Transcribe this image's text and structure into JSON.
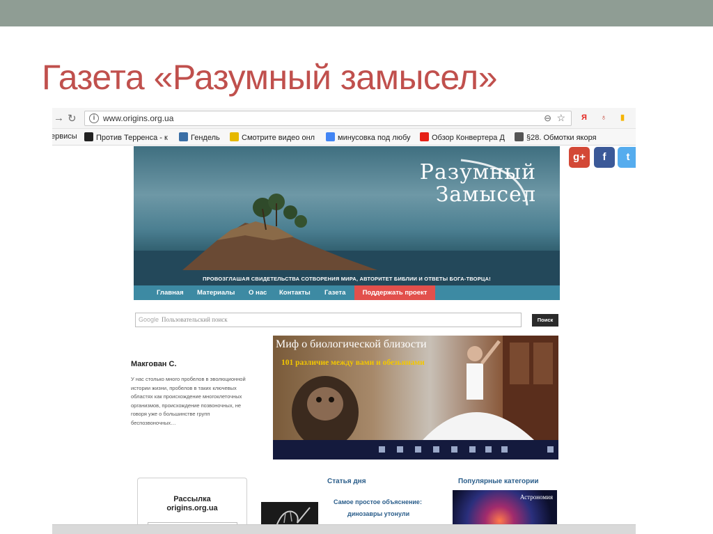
{
  "slide": {
    "title": "Газета «Разумный замысел»"
  },
  "browser": {
    "url": "www.origins.org.ua",
    "bookmarks": [
      {
        "label": "ервисы",
        "icon": "services-icon",
        "color": "#888888"
      },
      {
        "label": "Против Терренса - к",
        "icon": "bookmark-page-icon",
        "color": "#222222"
      },
      {
        "label": "Гендель",
        "icon": "music-icon",
        "color": "#3a6ea5"
      },
      {
        "label": "Смотрите видео онл",
        "icon": "video-play-icon",
        "color": "#e6b800"
      },
      {
        "label": "минусовка под любу",
        "icon": "google-g-icon",
        "color": "#4285f4"
      },
      {
        "label": "Обзор Конвертера Д",
        "icon": "youtube-icon",
        "color": "#e62117"
      },
      {
        "label": "§28. Обмотки якоря",
        "icon": "gear-icon",
        "color": "#555555"
      }
    ],
    "extensions": [
      {
        "icon": "yandex-icon",
        "glyph": "Я",
        "color": "#e52620"
      },
      {
        "icon": "bike-icon",
        "glyph": "♁",
        "color": "#c0392b"
      },
      {
        "icon": "bookmark-flag-icon",
        "glyph": "▮",
        "color": "#f5b400"
      }
    ]
  },
  "site": {
    "logo_line1": "Разумный",
    "logo_line2": "Замысел",
    "tagline": "ПРОВОЗГЛАШАЯ СВИДЕТЕЛЬСТВА СОТВОРЕНИЯ МИРА, АВТОРИТЕТ БИБЛИИ И ОТВЕТЫ БОГА-ТВОРЦА!",
    "menu": [
      "Главная",
      "Материалы",
      "О нас",
      "Контакты",
      "Газета"
    ],
    "menu_donate": "Поддержать проект",
    "search_google": "Google",
    "search_placeholder": "Пользовательский поиск",
    "search_button": "Поиск",
    "author": "Макгован С.",
    "excerpt": "У нас столько много пробелов в эволюционной истории жизни, пробелов в таких ключевых областях как происхождение многоклеточных организмов, происхождение позвоночных, не говоря уже о большинстве групп беспозвоночных…",
    "promo_title": "Миф о биологической близости",
    "promo_subtitle": "101 различие между вами и обезьянами",
    "subscribe_line1": "Рассылка",
    "subscribe_line2": "origins.org.ua",
    "article_heading": "Статья дня",
    "article_title_line1": "Самое простое объяснение:",
    "article_title_line2": "динозавры утонули",
    "categories_heading": "Популярные категории",
    "category_label": "Астрономия"
  },
  "social": [
    {
      "icon": "google-plus-icon",
      "glyph": "g+",
      "color": "#d34836"
    },
    {
      "icon": "facebook-icon",
      "glyph": "f",
      "color": "#3b5998"
    },
    {
      "icon": "twitter-icon",
      "glyph": "t",
      "color": "#55acee"
    }
  ]
}
